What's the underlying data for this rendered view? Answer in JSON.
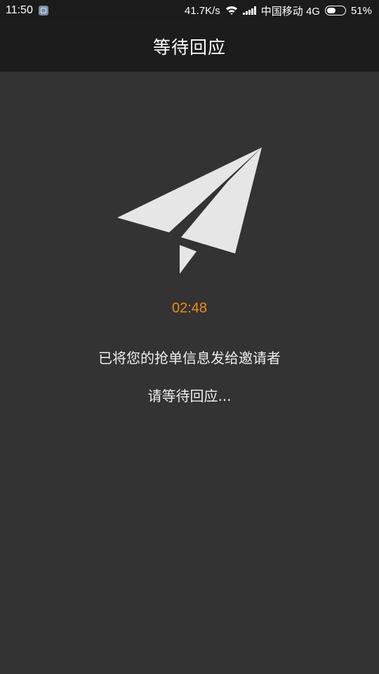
{
  "status_bar": {
    "time": "11:50",
    "net_speed": "41.7K/s",
    "carrier": "中国移动 4G",
    "battery_percent": "51%",
    "battery_level": 0.51,
    "icons": [
      "app-notification-icon",
      "wifi-icon",
      "signal-icon",
      "battery-icon"
    ]
  },
  "header": {
    "title": "等待回应"
  },
  "main": {
    "icon": "paper-plane-icon",
    "countdown": "02:48",
    "message_line1": "已将您的抢单信息发给邀请者",
    "message_line2": "请等待回应..."
  },
  "colors": {
    "background": "#333333",
    "header_background": "#1c1c1c",
    "status_background": "#1b1b1b",
    "accent_orange": "#f08a1c",
    "plane": "#e6e6e6",
    "text": "#eeeeee"
  }
}
